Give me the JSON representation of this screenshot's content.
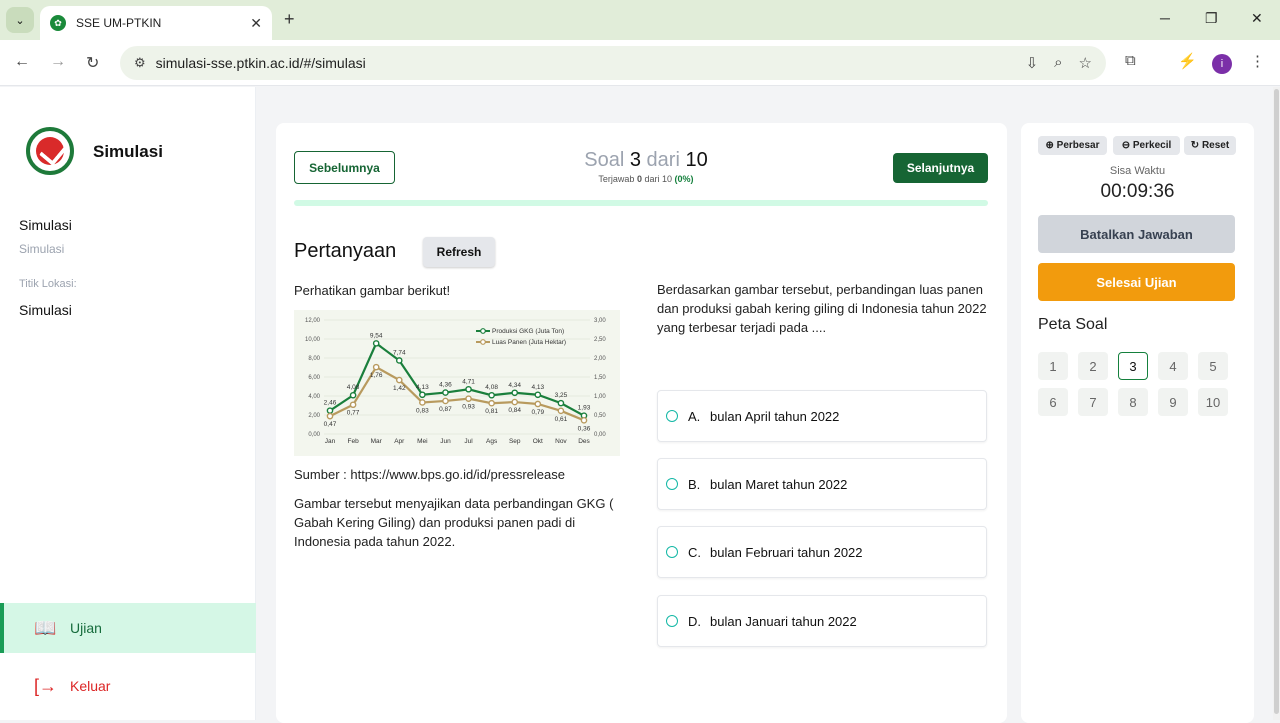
{
  "browser": {
    "tab_title": "SSE UM-PTKIN",
    "url": "simulasi-sse.ptkin.ac.id/#/simulasi",
    "avatar_letter": "i"
  },
  "sidebar": {
    "brand": "Simulasi",
    "name": "Simulasi",
    "sub": "Simulasi",
    "location_label": "Titik Lokasi:",
    "location_value": "Simulasi",
    "menu_ujian": "Ujian",
    "menu_keluar": "Keluar"
  },
  "main": {
    "prev_label": "Sebelumnya",
    "next_label": "Selanjutnya",
    "soal_word": "Soal",
    "current": "3",
    "dari_word": "dari",
    "total": "10",
    "answered_prefix": "Terjawab",
    "answered": "0",
    "answered_of": "dari 10",
    "answered_pct": "(0%)",
    "progress": 0,
    "heading": "Pertanyaan",
    "refresh_label": "Refresh",
    "intro": "Perhatikan gambar berikut!",
    "source": "Sumber : https://www.bps.go.id/id/pressrelease",
    "description": "Gambar tersebut menyajikan data perbandingan GKG ( Gabah Kering Giling) dan produksi panen padi di Indonesia pada tahun 2022.",
    "question": "Berdasarkan gambar tersebut, perbandingan luas panen dan produksi gabah kering giling  di Indonesia tahun 2022 yang terbesar terjadi pada ....",
    "options": [
      {
        "letter": "A.",
        "text": "bulan April tahun 2022"
      },
      {
        "letter": "B.",
        "text": "bulan Maret tahun 2022"
      },
      {
        "letter": "C.",
        "text": "bulan Februari tahun 2022"
      },
      {
        "letter": "D.",
        "text": "bulan Januari tahun 2022"
      }
    ]
  },
  "chart_data": {
    "type": "line",
    "categories": [
      "Jan",
      "Feb",
      "Mar",
      "Apr",
      "Mei",
      "Jun",
      "Jul",
      "Ags",
      "Sep",
      "Okt",
      "Nov",
      "Des"
    ],
    "series": [
      {
        "name": "Produksi GKG (Juta Ton)",
        "values": [
          2.46,
          4.08,
          9.54,
          7.74,
          4.13,
          4.36,
          4.71,
          4.08,
          4.34,
          4.13,
          3.25,
          1.93
        ],
        "labels": [
          "2,46",
          "4,08",
          "9,54",
          "7,74",
          "4,13",
          "4,36",
          "4,71",
          "4,08",
          "4,34",
          "4,13",
          "3,25",
          "1,93"
        ],
        "axis": "left",
        "color": "#1a7f3c"
      },
      {
        "name": "Luas Panen (Juta Hektar)",
        "values": [
          0.47,
          0.77,
          1.76,
          1.42,
          0.83,
          0.87,
          0.93,
          0.81,
          0.84,
          0.79,
          0.61,
          0.36
        ],
        "labels": [
          "0,47",
          "0,77",
          "1,76",
          "1,42",
          "0,83",
          "0,87",
          "0,93",
          "0,81",
          "0,84",
          "0,79",
          "0,61",
          "0,36"
        ],
        "axis": "right",
        "color": "#b89a5e"
      }
    ],
    "left_ticks": [
      "0,00",
      "2,00",
      "4,00",
      "6,00",
      "8,00",
      "10,00",
      "12,00"
    ],
    "right_ticks": [
      "0,00",
      "0,50",
      "1,00",
      "1,50",
      "2,00",
      "2,50",
      "3,00"
    ],
    "ylim_left": [
      0,
      12
    ],
    "ylim_right": [
      0,
      3
    ],
    "legend": "top-right",
    "grid": true
  },
  "panel": {
    "zoom_in": "Perbesar",
    "zoom_out": "Perkecil",
    "reset": "Reset",
    "sisa_label": "Sisa Waktu",
    "timer": "00:09:36",
    "cancel_label": "Batalkan Jawaban",
    "finish_label": "Selesai Ujian",
    "map_title": "Peta Soal",
    "numbers": [
      "1",
      "2",
      "3",
      "4",
      "5",
      "6",
      "7",
      "8",
      "9",
      "10"
    ],
    "active": "3"
  }
}
